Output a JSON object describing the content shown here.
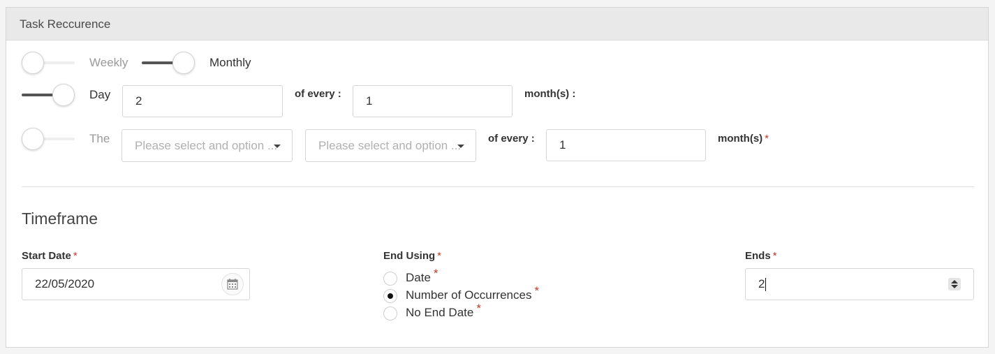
{
  "panel": {
    "title": "Task Reccurence"
  },
  "recurrence": {
    "weekly_label": "Weekly",
    "weekly_on": false,
    "monthly_label": "Monthly",
    "monthly_on": true
  },
  "day_row": {
    "toggle_on": true,
    "label": "Day",
    "day_value": "2",
    "of_every_label": "of every :",
    "every_value": "1",
    "unit_label": "month(s) :"
  },
  "the_row": {
    "toggle_on": false,
    "label": "The",
    "select1_placeholder": "Please select and option ...",
    "select2_placeholder": "Please select and option ...",
    "of_every_label": "of every :",
    "every_value": "1",
    "unit_label": "month(s)",
    "required_mark": "*"
  },
  "timeframe": {
    "title": "Timeframe",
    "start_date": {
      "label": "Start Date",
      "required_mark": "*",
      "value": "22/05/2020",
      "icon": "calendar-icon"
    },
    "end_using": {
      "label": "End Using",
      "required_mark": "*",
      "options": [
        {
          "label": "Date",
          "required_mark": "*",
          "checked": false
        },
        {
          "label": "Number of Occurrences",
          "required_mark": "*",
          "checked": true
        },
        {
          "label": "No End Date",
          "required_mark": "*",
          "checked": false
        }
      ]
    },
    "ends": {
      "label": "Ends",
      "required_mark": "*",
      "value": "2",
      "icon": "spinner-icon"
    }
  },
  "colors": {
    "required": "#c0392b",
    "toggle_on_track": "#555555",
    "header_bg": "#e9e9e9"
  }
}
